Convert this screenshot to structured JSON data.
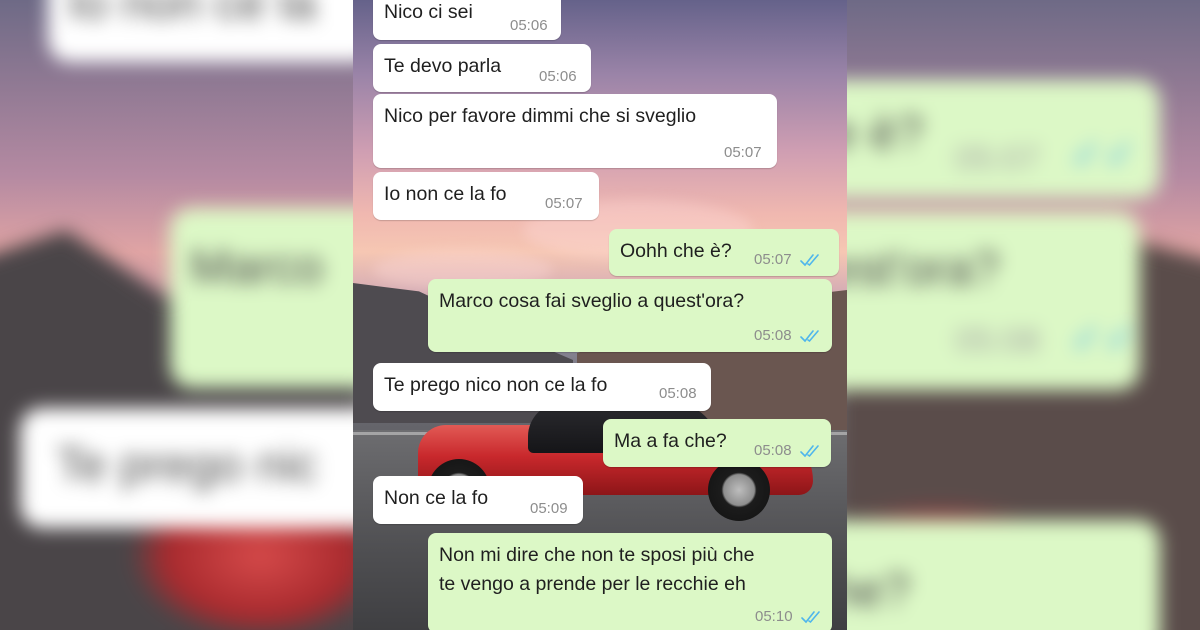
{
  "conversation": {
    "messages": [
      {
        "dir": "in",
        "text": "Nico ci sei",
        "time": "05:06"
      },
      {
        "dir": "in",
        "text": "Te devo parla",
        "time": "05:06"
      },
      {
        "dir": "in",
        "text": "Nico per favore dimmi che si sveglio",
        "time": "05:07"
      },
      {
        "dir": "in",
        "text": "Io non ce la fo",
        "time": "05:07"
      },
      {
        "dir": "out",
        "text": "Oohh che è?",
        "time": "05:07",
        "read": true
      },
      {
        "dir": "out",
        "text": "Marco cosa fai sveglio a quest'ora?",
        "time": "05:08",
        "read": true
      },
      {
        "dir": "in",
        "text": "Te prego nico non ce la fo",
        "time": "05:08"
      },
      {
        "dir": "out",
        "text": "Ma a fa che?",
        "time": "05:08",
        "read": true
      },
      {
        "dir": "in",
        "text": "Non ce la fo",
        "time": "05:09"
      },
      {
        "dir": "out",
        "text": "Non mi dire che non te sposi più che\nte vengo a prende per le recchie eh",
        "time": "05:10",
        "read": true
      }
    ]
  },
  "backdrop": {
    "left_top_text": "Io non ce la",
    "left_green_text": "Marco",
    "left_bottom_text": "Te prego nic",
    "right_top_text": "e è?",
    "right_top_time": "05:07",
    "right_mid_text": "est'ora?",
    "right_mid_time": "05:08",
    "right_bottom_text": "he?"
  },
  "colors": {
    "incoming_bubble": "#ffffff",
    "outgoing_bubble": "#dcf8c6",
    "read_check": "#4fb6ec",
    "timestamp": "#8d8d8d"
  },
  "icons": {
    "read_receipt": "double-check-icon"
  }
}
